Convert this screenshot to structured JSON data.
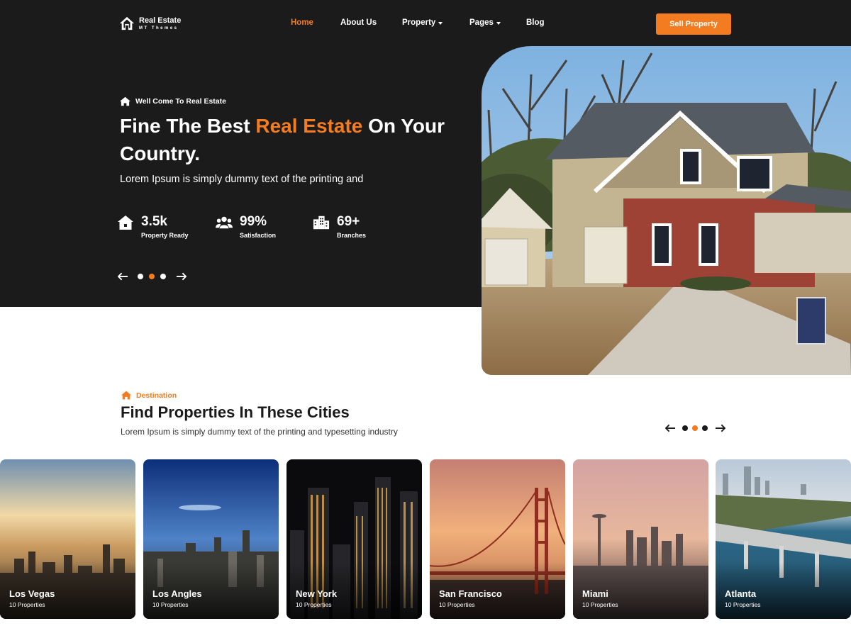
{
  "brand": {
    "name": "Real Estate",
    "tagline": "MT Themes",
    "logo_icon": "house-icon"
  },
  "nav": {
    "items": [
      {
        "label": "Home",
        "active": true,
        "dropdown": false
      },
      {
        "label": "About Us",
        "active": false,
        "dropdown": false
      },
      {
        "label": "Property",
        "active": false,
        "dropdown": true
      },
      {
        "label": "Pages",
        "active": false,
        "dropdown": true
      },
      {
        "label": "Blog",
        "active": false,
        "dropdown": false
      }
    ],
    "cta_label": "Sell Property"
  },
  "hero": {
    "kicker": "Well Come To Real Estate",
    "headline_part1": "Fine The Best ",
    "headline_accent": "Real Estate",
    "headline_part2": " On Your Country.",
    "description": "Lorem Ipsum is simply dummy text of the printing and",
    "stats": [
      {
        "value": "3.5k",
        "label": "Property Ready",
        "icon": "house-icon"
      },
      {
        "value": "99%",
        "label": "Satisfaction",
        "icon": "users-icon"
      },
      {
        "value": "69+",
        "label": "Branches",
        "icon": "buildings-icon"
      }
    ],
    "slider": {
      "slides": 3,
      "active_index": 1
    }
  },
  "destination": {
    "tag": "Destination",
    "title": "Find Properties In These Cities",
    "description": "Lorem Ipsum is simply dummy text of the printing and typesetting industry",
    "slider": {
      "slides": 3,
      "active_index": 1
    },
    "cities": [
      {
        "name": "Los Vegas",
        "count": "10 Properties"
      },
      {
        "name": "Los Angles",
        "count": "10 Properties"
      },
      {
        "name": "New York",
        "count": "10 Properties"
      },
      {
        "name": "San Francisco",
        "count": "10 Properties"
      },
      {
        "name": "Miami",
        "count": "10 Properties"
      },
      {
        "name": "Atlanta",
        "count": "10 Properties"
      }
    ]
  },
  "colors": {
    "accent": "#f47c20",
    "hero_bg": "#1b1b1b",
    "text_dark": "#1a1a1a"
  }
}
